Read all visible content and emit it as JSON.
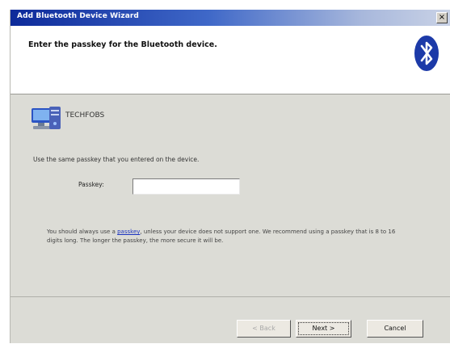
{
  "window": {
    "title": "Add Bluetooth Device Wizard",
    "close_label": "×"
  },
  "header": {
    "text": "Enter the passkey for the Bluetooth device."
  },
  "device": {
    "name": "TECHFOBS"
  },
  "form": {
    "instruction": "Use the same passkey that you entered on the device.",
    "passkey_label": "Passkey:",
    "passkey_value": ""
  },
  "note": {
    "before_link": "You should always use a ",
    "link_text": "passkey",
    "after_link": ", unless your device does not support one. We recommend using a passkey that is 8 to 16 digits long. The longer the passkey, the more secure it will be."
  },
  "buttons": {
    "back": "< Back",
    "next": "Next >",
    "cancel": "Cancel"
  },
  "colors": {
    "titlebar_start": "#0d2a9a",
    "bluetooth_blue": "#1c3aa8",
    "link": "#1a33c0"
  }
}
